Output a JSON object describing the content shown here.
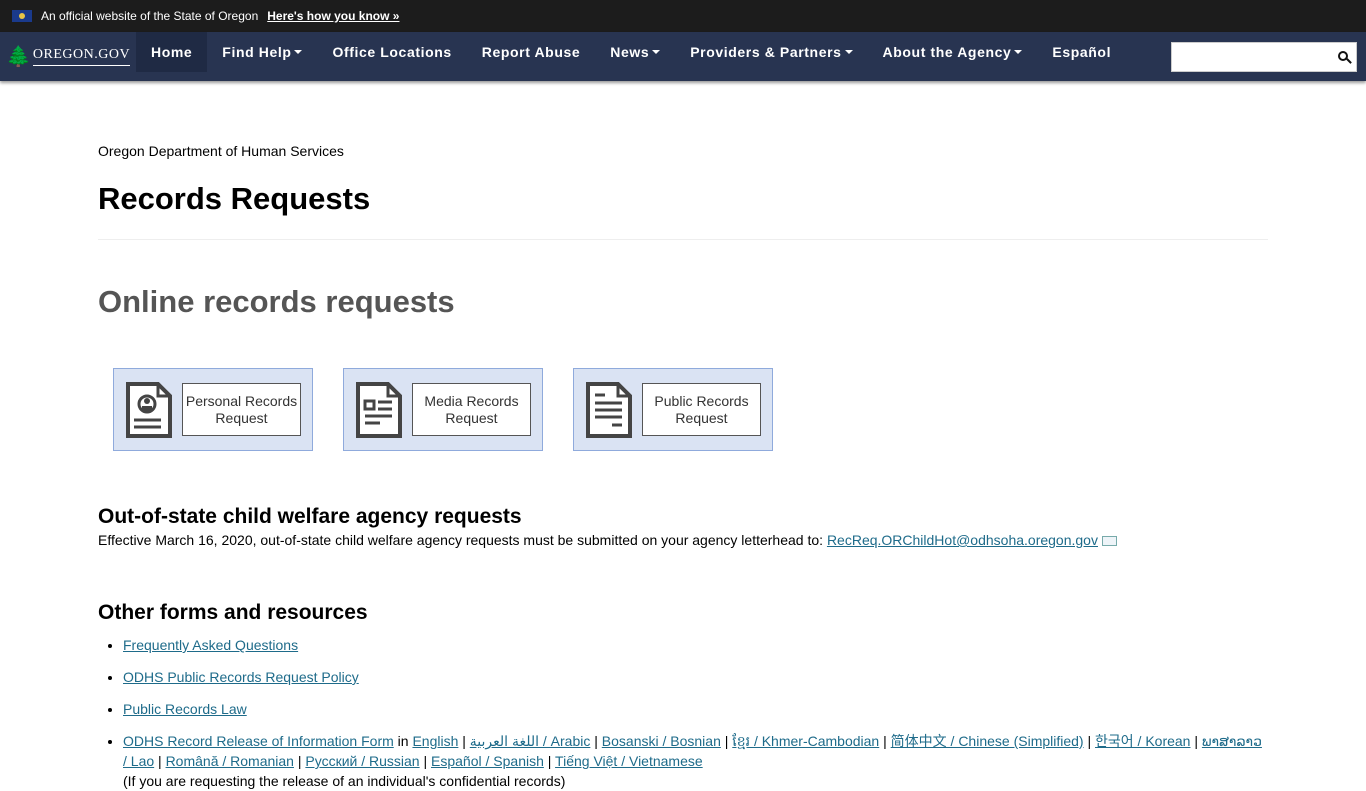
{
  "banner": {
    "text": "An official website of the State of Oregon",
    "link": "Here's how you know »"
  },
  "nav": {
    "logo": "OREGON.GOV",
    "items": [
      {
        "label": "Home",
        "dropdown": false,
        "active": true
      },
      {
        "label": "Find Help",
        "dropdown": true
      },
      {
        "label": "Office Locations",
        "dropdown": false
      },
      {
        "label": "Report Abuse",
        "dropdown": false
      },
      {
        "label": "News",
        "dropdown": true
      },
      {
        "label": "Providers & Partners",
        "dropdown": true
      },
      {
        "label": "About the Agency",
        "dropdown": true
      },
      {
        "label": "Español",
        "dropdown": false
      }
    ],
    "search": {
      "value": "",
      "placeholder": ""
    }
  },
  "page": {
    "agency": "Oregon Department of Human Services",
    "title": "Records Requests",
    "online_heading": "Online records requests",
    "tiles": [
      {
        "label": "Personal Records Request",
        "icon": "personal-document-icon"
      },
      {
        "label": "Media Records Request",
        "icon": "media-document-icon"
      },
      {
        "label": "Public Records Request",
        "icon": "public-document-icon"
      }
    ],
    "oos": {
      "heading": "Out-of-state child welfare agency requests",
      "text": "Effective March 16, 2020, out-of-state child welfare agency requests must be submitted on your agency letterhead to: ",
      "email": "RecReq.ORChildHot@odhsoha.oregon.gov"
    },
    "other": {
      "heading": "Other forms and resources",
      "links": [
        "Frequently Asked Questions",
        "ODHS Public Records Request Policy",
        "Public Records Law"
      ],
      "release_form": "ODHS Record Release of Information Form",
      "in_word": "in",
      "languages": [
        "English",
        "اللغة العربية / Arabic",
        "Bosanski / Bosnian",
        "ខ្មែរ / Khmer-Cambodian",
        "简体中文 / Chinese (Simplified)",
        "한국어 / Korean",
        "ພາສາລາວ / Lao",
        "Română / Romanian",
        "Русский / Russian",
        "Español / Spanish",
        "Tiếng Việt / Vietnamese"
      ],
      "note": "(If you are requesting the release of an individual's confidential records)"
    }
  }
}
